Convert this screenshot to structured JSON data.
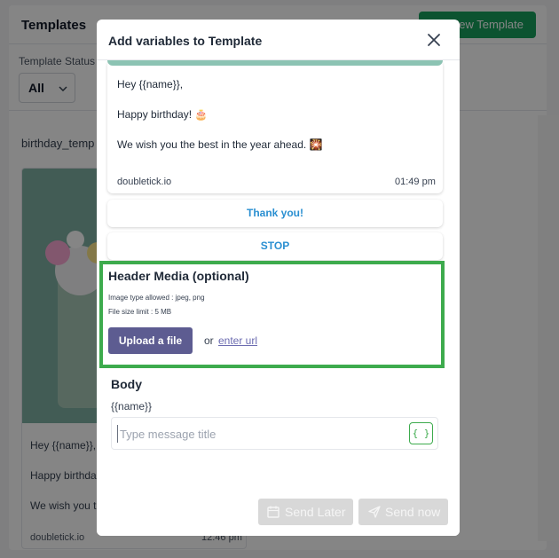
{
  "background": {
    "title": "Templates",
    "new_template_label": "New Template",
    "status_label": "Template Status",
    "status_value": "All",
    "card_name": "birthday_temp",
    "card_lines": [
      "Hey {{name}},",
      "Happy birthda",
      "We wish you t"
    ],
    "card_footer": "doubletick.io",
    "card_time": "12:46 pm"
  },
  "modal": {
    "title": "Add variables to Template",
    "preview": {
      "greeting": "Hey {{name}},",
      "line2": "Happy birthday! 🎂",
      "line3": "We wish you the best in the year ahead. 🎇",
      "footer": "doubletick.io",
      "time": "01:49 pm"
    },
    "quick_replies": [
      "Thank you!",
      "STOP"
    ],
    "header_media": {
      "title": "Header Media (optional)",
      "allowed_types": "Image type allowed : jpeg, png",
      "size_limit": "File size limit : 5 MB",
      "upload_label": "Upload a file",
      "or_label": "or",
      "url_label": "enter url"
    },
    "body": {
      "title": "Body",
      "variable": "{{name}}",
      "input_placeholder": "Type message title",
      "var_button": "{ }"
    },
    "footer": {
      "send_later": "Send Later",
      "send_now": "Send now"
    }
  },
  "colors": {
    "primary_green": "#17a05d",
    "highlight_green": "#3dab4d",
    "upload_purple": "#5d5c91",
    "quick_reply_blue": "#2a8fd1",
    "disabled_gray": "#d8d8d8"
  },
  "icons": {
    "close": "close-icon",
    "calendar": "calendar-icon",
    "send": "send-icon",
    "chevron": "chevron-down-icon"
  }
}
